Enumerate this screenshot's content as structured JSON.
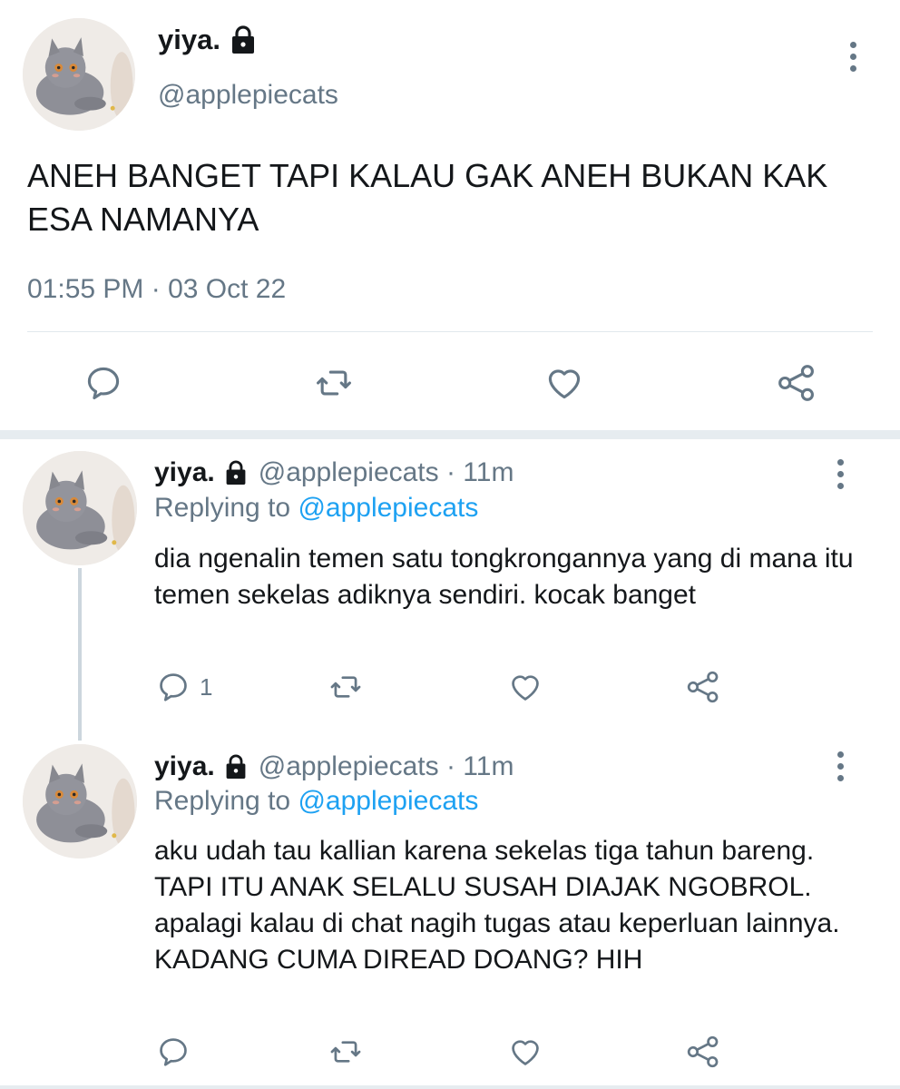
{
  "main_tweet": {
    "display_name": "yiya.",
    "handle": "@applepiecats",
    "text": "ANEH BANGET TAPI KALAU GAK ANEH BUKAN KAK ESA NAMANYA",
    "timestamp": "01:55 PM · 03 Oct 22",
    "lock_icon": "lock-icon",
    "actions": [
      "reply-icon",
      "retweet-icon",
      "like-icon",
      "share-icon"
    ]
  },
  "replies": [
    {
      "display_name": "yiya.",
      "meta": "@applepiecats · 11m",
      "replying_prefix": "Replying to ",
      "replying_to": "@applepiecats",
      "text": "dia ngenalin temen satu tongkrongannya yang di mana itu temen sekelas adiknya sendiri. kocak banget",
      "reply_count": "1"
    },
    {
      "display_name": "yiya.",
      "meta": "@applepiecats · 11m",
      "replying_prefix": "Replying to ",
      "replying_to": "@applepiecats",
      "text": "aku udah tau kallian karena sekelas tiga tahun bareng. TAPI ITU ANAK SELALU SUSAH DIAJAK NGOBROL. apalagi kalau di chat nagih tugas atau keperluan lainnya. KADANG CUMA DIREAD DOANG? HIH",
      "reply_count": ""
    }
  ],
  "colors": {
    "text_primary": "#14171a",
    "text_secondary": "#657786",
    "mention": "#1da1f2",
    "divider": "#e1e8ed",
    "thread_line": "#ccd6dd"
  }
}
